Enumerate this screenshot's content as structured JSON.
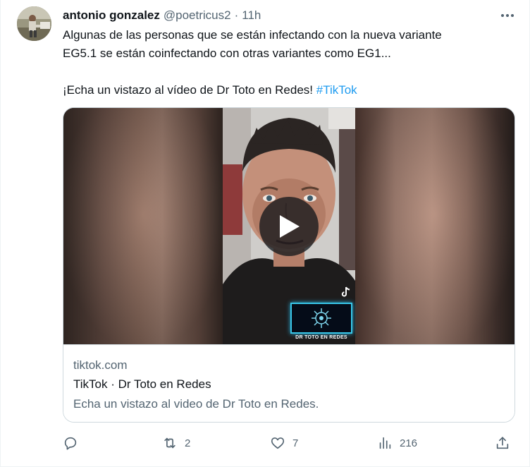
{
  "tweet": {
    "author_name": "antonio gonzalez",
    "author_handle": "@poetricus2",
    "separator": "·",
    "time": "11h",
    "text_line1": "Algunas de las personas que se están infectando con la nueva variante",
    "text_line2": "EG5.1 se están coinfectando con otras variantes como EG1...",
    "text_line3": "¡Echa un vistazo al vídeo de Dr Toto en Redes! ",
    "hashtag": "#TikTok"
  },
  "card": {
    "domain": "tiktok.com",
    "title": "TikTok · Dr Toto en Redes",
    "description": "Echa un vistazo al video de Dr Toto en Redes.",
    "video_overlay_caption": "DR TOTO EN REDES"
  },
  "actions": {
    "reply_count": "",
    "retweet_count": "2",
    "like_count": "7",
    "views_count": "216"
  },
  "icons": {
    "more": "more-horizontal-icon",
    "reply": "reply-icon",
    "retweet": "retweet-icon",
    "like": "heart-icon",
    "views": "views-chart-icon",
    "share": "share-icon",
    "play": "play-icon",
    "tiktok": "tiktok-logo-icon"
  },
  "colors": {
    "text_primary": "#0f1419",
    "text_secondary": "#536471",
    "link": "#1d9bf0",
    "border": "#cfd9de"
  }
}
